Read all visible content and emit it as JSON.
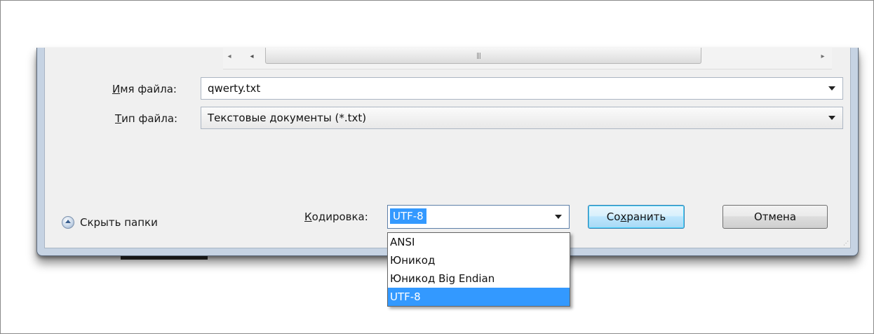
{
  "dialog": {
    "file_name_label_underline": "И",
    "file_name_label_rest": "мя файла:",
    "file_name_value": "qwerty.txt",
    "file_type_label_underline": "Т",
    "file_type_label_rest": "ип файла:",
    "file_type_value": "Текстовые документы (*.txt)",
    "hide_folders_label": "Скрыть папки",
    "encoding_label_underline": "К",
    "encoding_label_rest": "одировка:",
    "encoding_selected": "UTF-8",
    "encoding_options": [
      "ANSI",
      "Юникод",
      "Юникод Big Endian",
      "UTF-8"
    ],
    "save_button_before": "Со",
    "save_button_underline": "х",
    "save_button_after": "ранить",
    "cancel_button": "Отмена"
  },
  "colors": {
    "selection": "#3399ff",
    "dialog_frame": "#c6d3e3",
    "client_bg": "#f0f0f0"
  },
  "icons": {
    "hide_folders": "chevron-up-circle-icon",
    "dropdown": "triangle-down-icon"
  }
}
